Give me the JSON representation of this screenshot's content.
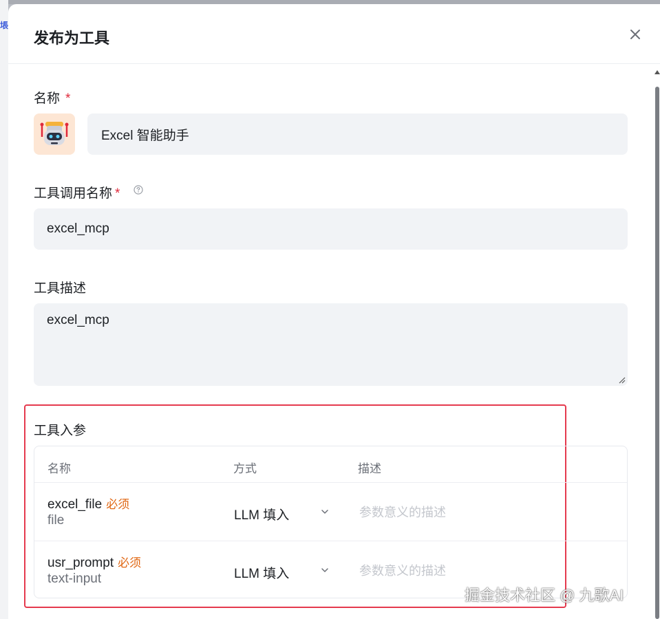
{
  "background": {
    "side_tag": "㙊"
  },
  "dialog": {
    "title": "发布为工具",
    "close_icon": "close-icon"
  },
  "form": {
    "name": {
      "label": "名称",
      "required_mark": "*",
      "avatar_icon": "robot-avatar-icon",
      "value": "Excel 智能助手"
    },
    "call_name": {
      "label": "工具调用名称",
      "required_mark": "*",
      "help_icon": "question-circle-icon",
      "value": "excel_mcp"
    },
    "description": {
      "label": "工具描述",
      "value": "excel_mcp"
    },
    "params": {
      "label": "工具入参",
      "columns": [
        "名称",
        "方式",
        "描述"
      ],
      "rows": [
        {
          "name": "excel_file",
          "required": "必须",
          "type": "file",
          "mode": "LLM 填入",
          "desc_placeholder": "参数意义的描述"
        },
        {
          "name": "usr_prompt",
          "required": "必须",
          "type": "text-input",
          "mode": "LLM 填入",
          "desc_placeholder": "参数意义的描述"
        }
      ]
    }
  },
  "watermark": "掘金技术社区 @ 九歌AI",
  "colors": {
    "required": "#e0293b",
    "required_tag": "#e06612",
    "highlight": "#e5394d",
    "field_bg": "#f1f3f6"
  }
}
